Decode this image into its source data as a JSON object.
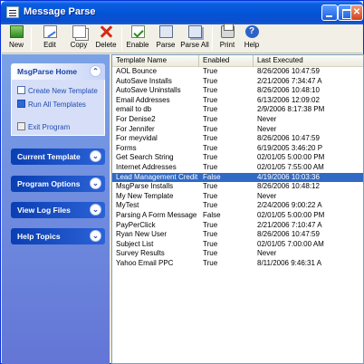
{
  "window": {
    "title": "Message Parse"
  },
  "toolbar": {
    "buttons": [
      {
        "label": "New",
        "icon": "new-icon"
      },
      {
        "label": "Edit",
        "icon": "edit-icon"
      },
      {
        "label": "Copy",
        "icon": "copy-icon"
      },
      {
        "label": "Delete",
        "icon": "delete-icon"
      },
      {
        "label": "Enable",
        "icon": "enable-icon"
      },
      {
        "label": "Parse",
        "icon": "parse-icon"
      },
      {
        "label": "Parse All",
        "icon": "parse-all-icon"
      },
      {
        "label": "Print",
        "icon": "print-icon"
      },
      {
        "label": "Help",
        "icon": "help-icon"
      }
    ]
  },
  "sidebar": {
    "home": {
      "title": "MsgParse Home",
      "tasks": [
        "Create New Template",
        "Run All Templates",
        "Exit Program"
      ]
    },
    "sections": [
      "Current Template",
      "Program Options",
      "View Log Files",
      "Help Topics"
    ]
  },
  "list": {
    "columns": [
      "Template Name",
      "Enabled",
      "Last Executed"
    ],
    "rows": [
      [
        "AOL Bounce",
        "True",
        "8/26/2006 10:47:59"
      ],
      [
        "AutoSave Installs",
        "True",
        "2/21/2006 7:34:47 A"
      ],
      [
        "AutoSave Uninstalls",
        "True",
        "8/26/2006 10:48:10"
      ],
      [
        "Email Addresses",
        "True",
        "6/13/2006 12:09:02"
      ],
      [
        "email to db",
        "True",
        "2/9/2006 8:17:38 PM"
      ],
      [
        "For Denise2",
        "True",
        "Never"
      ],
      [
        "For Jennifer",
        "True",
        "Never"
      ],
      [
        "For meyvidal",
        "True",
        "8/26/2006 10:47:59"
      ],
      [
        "Forms",
        "True",
        "6/19/2005 3:46:20 P"
      ],
      [
        "Get Search String",
        "True",
        "02/01/05 5:00:00 PM"
      ],
      [
        "Internet Addresses",
        "True",
        "02/01/05 7:55:00 AM"
      ],
      [
        "Lead Management Credit A...",
        "False",
        "4/19/2006 10:03:36"
      ],
      [
        "MsgParse Installs",
        "True",
        "8/26/2006 10:48:12"
      ],
      [
        "My New Template",
        "True",
        "Never"
      ],
      [
        "MyTest",
        "True",
        "2/24/2006 9:00:22 A"
      ],
      [
        "Parsing A Form Message",
        "False",
        "02/01/05 5:00:00 PM"
      ],
      [
        "PayPerClick",
        "True",
        "2/21/2006 7:10:47 A"
      ],
      [
        "Ryan New User",
        "True",
        "8/26/2006 10:47:59"
      ],
      [
        "Subject List",
        "True",
        "02/01/05 7:00:00 AM"
      ],
      [
        "Survey Results",
        "True",
        "Never"
      ],
      [
        "Yahoo Email PPC",
        "True",
        "8/11/2006 9:46:31 A"
      ]
    ],
    "selected_index": 11
  },
  "colors": {
    "selection": "#316ac5",
    "title_bar": "#0554d6",
    "sidebar": "#7ba2e7"
  }
}
